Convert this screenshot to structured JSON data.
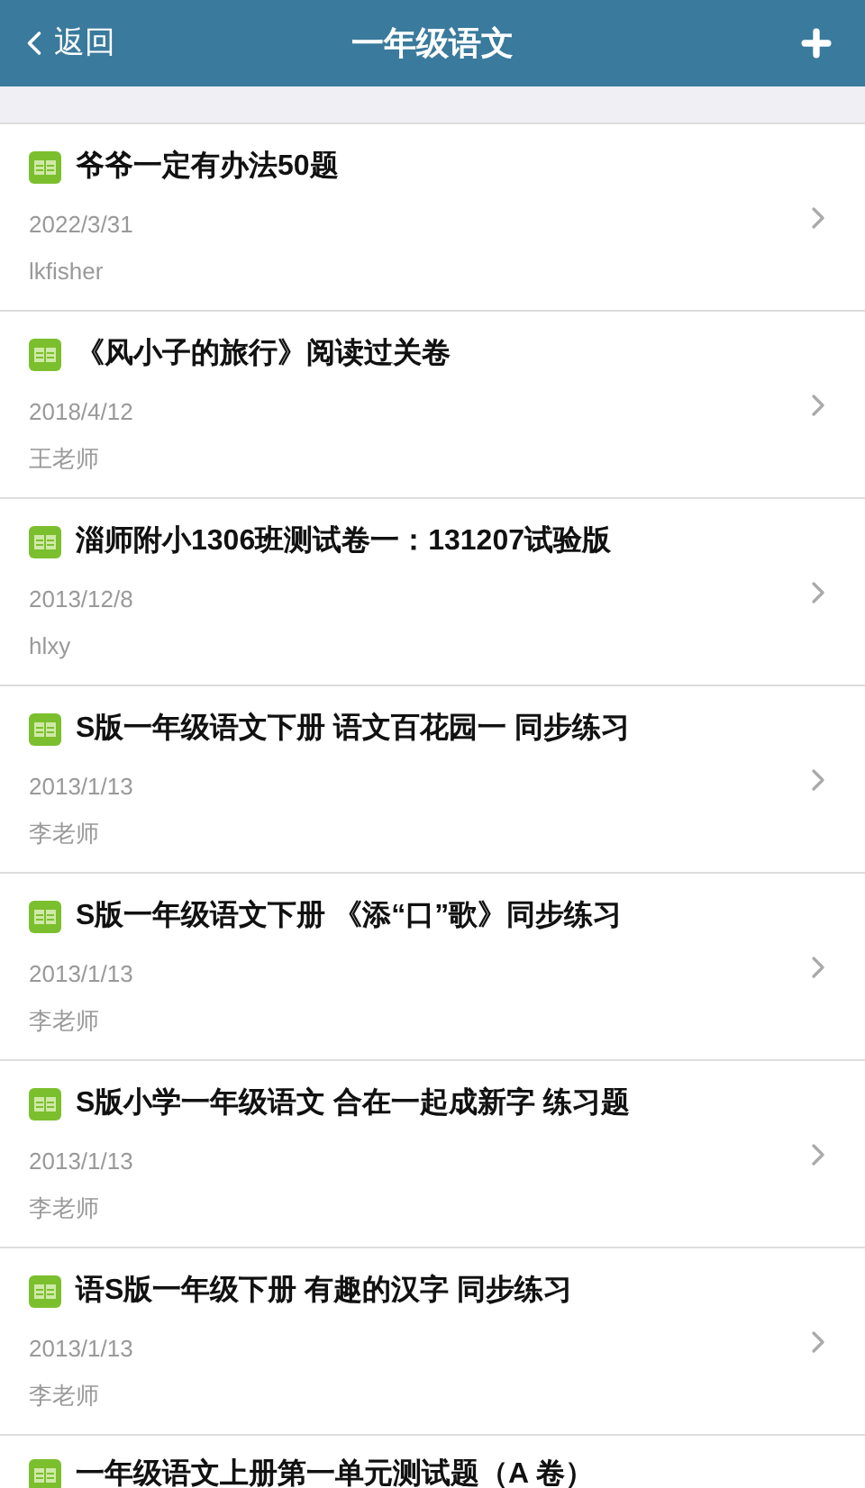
{
  "header": {
    "back": "返回",
    "title": "一年级语文"
  },
  "items": [
    {
      "title": "爷爷一定有办法50题",
      "date": "2022/3/31",
      "author": "lkfisher"
    },
    {
      "title": "《风小子的旅行》阅读过关卷",
      "date": "2018/4/12",
      "author": "王老师"
    },
    {
      "title": "淄师附小1306班测试卷一：131207试验版",
      "date": "2013/12/8",
      "author": "hlxy"
    },
    {
      "title": "S版一年级语文下册 语文百花园一 同步练习",
      "date": "2013/1/13",
      "author": "李老师"
    },
    {
      "title": "S版一年级语文下册 《添“口”歌》同步练习",
      "date": "2013/1/13",
      "author": "李老师"
    },
    {
      "title": "S版小学一年级语文 合在一起成新字 练习题",
      "date": "2013/1/13",
      "author": "李老师"
    },
    {
      "title": "语S版一年级下册 有趣的汉字 同步练习",
      "date": "2013/1/13",
      "author": "李老师"
    },
    {
      "title": "一年级语文上册第一单元测试题（A 卷）"
    }
  ]
}
